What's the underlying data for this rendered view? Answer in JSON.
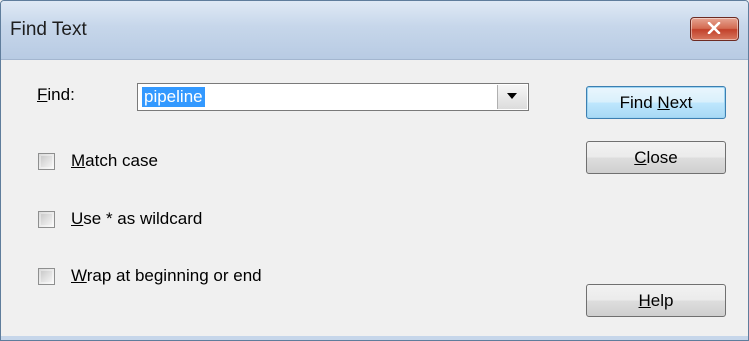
{
  "window": {
    "title": "Find Text",
    "close_icon": "close-x-icon"
  },
  "find": {
    "label_first": "F",
    "label_rest": "ind:",
    "value": "pipeline",
    "dropdown_icon": "chevron-down-icon"
  },
  "options": [
    {
      "first": "M",
      "rest": "atch case",
      "checked": false
    },
    {
      "first": "U",
      "rest": "se * as wildcard",
      "checked": false
    },
    {
      "first": "W",
      "rest": "rap at beginning or end",
      "checked": false
    }
  ],
  "buttons": {
    "find_next_pre": "Find ",
    "find_next_u": "N",
    "find_next_post": "ext",
    "close_u": "C",
    "close_post": "lose",
    "help_u": "H",
    "help_post": "elp"
  },
  "colors": {
    "selection": "#3399ff",
    "close_button": "#c2402a",
    "default_button_border": "#3c7fb1"
  }
}
